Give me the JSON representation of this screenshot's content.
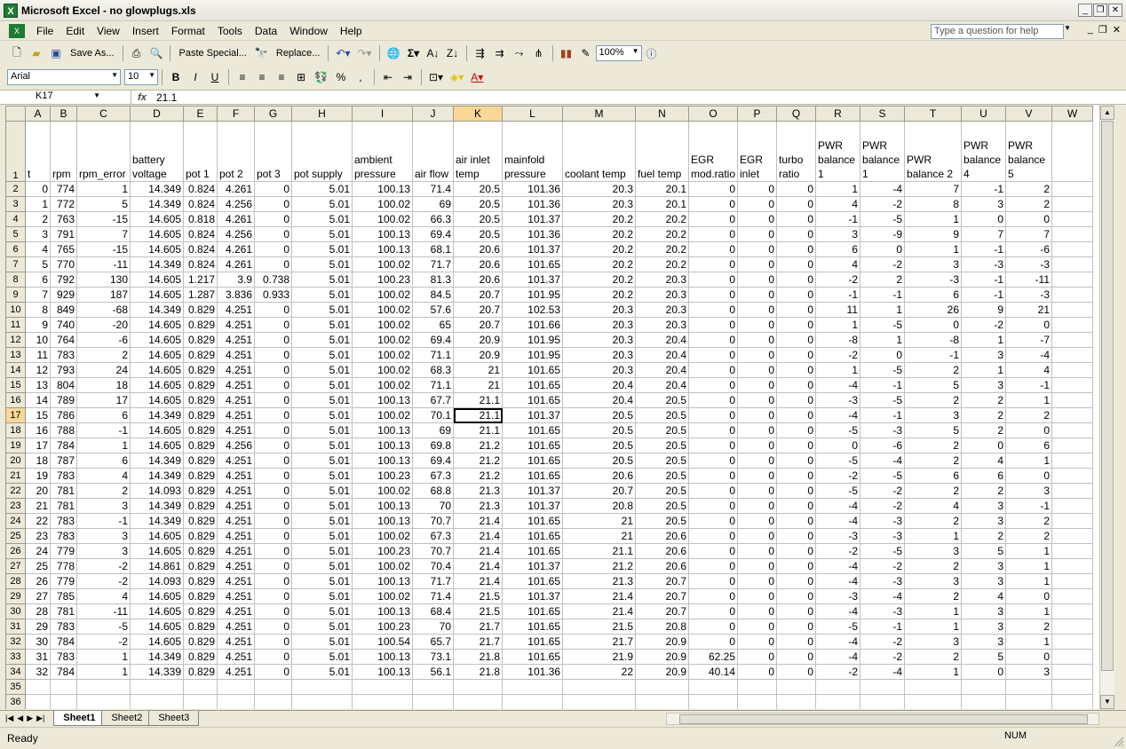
{
  "window": {
    "title": "Microsoft Excel - no glowplugs.xls",
    "app_icon": "X"
  },
  "menu": {
    "items": [
      "File",
      "Edit",
      "View",
      "Insert",
      "Format",
      "Tools",
      "Data",
      "Window",
      "Help"
    ],
    "help_placeholder": "Type a question for help"
  },
  "toolbar": {
    "save_as": "Save As...",
    "paste_special": "Paste Special...",
    "replace": "Replace...",
    "zoom": "100%"
  },
  "format": {
    "font": "Arial",
    "size": "10",
    "bold": "B",
    "italic": "I",
    "underline": "U",
    "percent": "%",
    "comma": ","
  },
  "formula_bar": {
    "name_box": "K17",
    "fx": "fx",
    "value": "21.1"
  },
  "columns": [
    "A",
    "B",
    "C",
    "D",
    "E",
    "F",
    "G",
    "H",
    "I",
    "J",
    "K",
    "L",
    "M",
    "N",
    "O",
    "P",
    "Q",
    "R",
    "S",
    "T",
    "U",
    "V",
    "W"
  ],
  "header_row": [
    "t",
    "rpm",
    "rpm_error",
    "battery voltage",
    "pot 1",
    "pot 2",
    "pot 3",
    "pot supply",
    "ambient pressure",
    "air flow",
    "air inlet temp",
    "mainfold pressure",
    "coolant temp",
    "fuel temp",
    "EGR mod.ratio",
    "EGR inlet",
    "turbo ratio",
    "PWR balance 1",
    "PWR balance 1",
    "PWR balance 2",
    "PWR balance 4",
    "PWR balance 5",
    ""
  ],
  "rows": [
    [
      "0",
      "774",
      "1",
      "14.349",
      "0.824",
      "4.261",
      "0",
      "5.01",
      "100.13",
      "71.4",
      "20.5",
      "101.36",
      "20.3",
      "20.1",
      "0",
      "0",
      "0",
      "1",
      "-4",
      "7",
      "-1",
      "2"
    ],
    [
      "1",
      "772",
      "5",
      "14.349",
      "0.824",
      "4.256",
      "0",
      "5.01",
      "100.02",
      "69",
      "20.5",
      "101.36",
      "20.3",
      "20.1",
      "0",
      "0",
      "0",
      "4",
      "-2",
      "8",
      "3",
      "2"
    ],
    [
      "2",
      "763",
      "-15",
      "14.605",
      "0.818",
      "4.261",
      "0",
      "5.01",
      "100.02",
      "66.3",
      "20.5",
      "101.37",
      "20.2",
      "20.2",
      "0",
      "0",
      "0",
      "-1",
      "-5",
      "1",
      "0",
      "0"
    ],
    [
      "3",
      "791",
      "7",
      "14.605",
      "0.824",
      "4.256",
      "0",
      "5.01",
      "100.13",
      "69.4",
      "20.5",
      "101.36",
      "20.2",
      "20.2",
      "0",
      "0",
      "0",
      "3",
      "-9",
      "9",
      "7",
      "7"
    ],
    [
      "4",
      "765",
      "-15",
      "14.605",
      "0.824",
      "4.261",
      "0",
      "5.01",
      "100.13",
      "68.1",
      "20.6",
      "101.37",
      "20.2",
      "20.2",
      "0",
      "0",
      "0",
      "6",
      "0",
      "1",
      "-1",
      "-6"
    ],
    [
      "5",
      "770",
      "-11",
      "14.349",
      "0.824",
      "4.261",
      "0",
      "5.01",
      "100.02",
      "71.7",
      "20.6",
      "101.65",
      "20.2",
      "20.2",
      "0",
      "0",
      "0",
      "4",
      "-2",
      "3",
      "-3",
      "-3"
    ],
    [
      "6",
      "792",
      "130",
      "14.605",
      "1.217",
      "3.9",
      "0.738",
      "5.01",
      "100.23",
      "81.3",
      "20.6",
      "101.37",
      "20.2",
      "20.3",
      "0",
      "0",
      "0",
      "-2",
      "2",
      "-3",
      "-1",
      "-11"
    ],
    [
      "7",
      "929",
      "187",
      "14.605",
      "1.287",
      "3.836",
      "0.933",
      "5.01",
      "100.02",
      "84.5",
      "20.7",
      "101.95",
      "20.2",
      "20.3",
      "0",
      "0",
      "0",
      "-1",
      "-1",
      "6",
      "-1",
      "-3"
    ],
    [
      "8",
      "849",
      "-68",
      "14.349",
      "0.829",
      "4.251",
      "0",
      "5.01",
      "100.02",
      "57.6",
      "20.7",
      "102.53",
      "20.3",
      "20.3",
      "0",
      "0",
      "0",
      "11",
      "1",
      "26",
      "9",
      "21"
    ],
    [
      "9",
      "740",
      "-20",
      "14.605",
      "0.829",
      "4.251",
      "0",
      "5.01",
      "100.02",
      "65",
      "20.7",
      "101.66",
      "20.3",
      "20.3",
      "0",
      "0",
      "0",
      "1",
      "-5",
      "0",
      "-2",
      "0"
    ],
    [
      "10",
      "764",
      "-6",
      "14.605",
      "0.829",
      "4.251",
      "0",
      "5.01",
      "100.02",
      "69.4",
      "20.9",
      "101.95",
      "20.3",
      "20.4",
      "0",
      "0",
      "0",
      "-8",
      "1",
      "-8",
      "1",
      "-7"
    ],
    [
      "11",
      "783",
      "2",
      "14.605",
      "0.829",
      "4.251",
      "0",
      "5.01",
      "100.02",
      "71.1",
      "20.9",
      "101.95",
      "20.3",
      "20.4",
      "0",
      "0",
      "0",
      "-2",
      "0",
      "-1",
      "3",
      "-4"
    ],
    [
      "12",
      "793",
      "24",
      "14.605",
      "0.829",
      "4.251",
      "0",
      "5.01",
      "100.02",
      "68.3",
      "21",
      "101.65",
      "20.3",
      "20.4",
      "0",
      "0",
      "0",
      "1",
      "-5",
      "2",
      "1",
      "4"
    ],
    [
      "13",
      "804",
      "18",
      "14.605",
      "0.829",
      "4.251",
      "0",
      "5.01",
      "100.02",
      "71.1",
      "21",
      "101.65",
      "20.4",
      "20.4",
      "0",
      "0",
      "0",
      "-4",
      "-1",
      "5",
      "3",
      "-1"
    ],
    [
      "14",
      "789",
      "17",
      "14.605",
      "0.829",
      "4.251",
      "0",
      "5.01",
      "100.13",
      "67.7",
      "21.1",
      "101.65",
      "20.4",
      "20.5",
      "0",
      "0",
      "0",
      "-3",
      "-5",
      "2",
      "2",
      "1"
    ],
    [
      "15",
      "786",
      "6",
      "14.349",
      "0.829",
      "4.251",
      "0",
      "5.01",
      "100.02",
      "70.1",
      "21.1",
      "101.37",
      "20.5",
      "20.5",
      "0",
      "0",
      "0",
      "-4",
      "-1",
      "3",
      "2",
      "2"
    ],
    [
      "16",
      "788",
      "-1",
      "14.605",
      "0.829",
      "4.251",
      "0",
      "5.01",
      "100.13",
      "69",
      "21.1",
      "101.65",
      "20.5",
      "20.5",
      "0",
      "0",
      "0",
      "-5",
      "-3",
      "5",
      "2",
      "0"
    ],
    [
      "17",
      "784",
      "1",
      "14.605",
      "0.829",
      "4.256",
      "0",
      "5.01",
      "100.13",
      "69.8",
      "21.2",
      "101.65",
      "20.5",
      "20.5",
      "0",
      "0",
      "0",
      "0",
      "-6",
      "2",
      "0",
      "6"
    ],
    [
      "18",
      "787",
      "6",
      "14.349",
      "0.829",
      "4.251",
      "0",
      "5.01",
      "100.13",
      "69.4",
      "21.2",
      "101.65",
      "20.5",
      "20.5",
      "0",
      "0",
      "0",
      "-5",
      "-4",
      "2",
      "4",
      "1"
    ],
    [
      "19",
      "783",
      "4",
      "14.349",
      "0.829",
      "4.251",
      "0",
      "5.01",
      "100.23",
      "67.3",
      "21.2",
      "101.65",
      "20.6",
      "20.5",
      "0",
      "0",
      "0",
      "-2",
      "-5",
      "6",
      "6",
      "0"
    ],
    [
      "20",
      "781",
      "2",
      "14.093",
      "0.829",
      "4.251",
      "0",
      "5.01",
      "100.02",
      "68.8",
      "21.3",
      "101.37",
      "20.7",
      "20.5",
      "0",
      "0",
      "0",
      "-5",
      "-2",
      "2",
      "2",
      "3"
    ],
    [
      "21",
      "781",
      "3",
      "14.349",
      "0.829",
      "4.251",
      "0",
      "5.01",
      "100.13",
      "70",
      "21.3",
      "101.37",
      "20.8",
      "20.5",
      "0",
      "0",
      "0",
      "-4",
      "-2",
      "4",
      "3",
      "-1"
    ],
    [
      "22",
      "783",
      "-1",
      "14.349",
      "0.829",
      "4.251",
      "0",
      "5.01",
      "100.13",
      "70.7",
      "21.4",
      "101.65",
      "21",
      "20.5",
      "0",
      "0",
      "0",
      "-4",
      "-3",
      "2",
      "3",
      "2"
    ],
    [
      "23",
      "783",
      "3",
      "14.605",
      "0.829",
      "4.251",
      "0",
      "5.01",
      "100.02",
      "67.3",
      "21.4",
      "101.65",
      "21",
      "20.6",
      "0",
      "0",
      "0",
      "-3",
      "-3",
      "1",
      "2",
      "2"
    ],
    [
      "24",
      "779",
      "3",
      "14.605",
      "0.829",
      "4.251",
      "0",
      "5.01",
      "100.23",
      "70.7",
      "21.4",
      "101.65",
      "21.1",
      "20.6",
      "0",
      "0",
      "0",
      "-2",
      "-5",
      "3",
      "5",
      "1"
    ],
    [
      "25",
      "778",
      "-2",
      "14.861",
      "0.829",
      "4.251",
      "0",
      "5.01",
      "100.02",
      "70.4",
      "21.4",
      "101.37",
      "21.2",
      "20.6",
      "0",
      "0",
      "0",
      "-4",
      "-2",
      "2",
      "3",
      "1"
    ],
    [
      "26",
      "779",
      "-2",
      "14.093",
      "0.829",
      "4.251",
      "0",
      "5.01",
      "100.13",
      "71.7",
      "21.4",
      "101.65",
      "21.3",
      "20.7",
      "0",
      "0",
      "0",
      "-4",
      "-3",
      "3",
      "3",
      "1"
    ],
    [
      "27",
      "785",
      "4",
      "14.605",
      "0.829",
      "4.251",
      "0",
      "5.01",
      "100.02",
      "71.4",
      "21.5",
      "101.37",
      "21.4",
      "20.7",
      "0",
      "0",
      "0",
      "-3",
      "-4",
      "2",
      "4",
      "0"
    ],
    [
      "28",
      "781",
      "-11",
      "14.605",
      "0.829",
      "4.251",
      "0",
      "5.01",
      "100.13",
      "68.4",
      "21.5",
      "101.65",
      "21.4",
      "20.7",
      "0",
      "0",
      "0",
      "-4",
      "-3",
      "1",
      "3",
      "1"
    ],
    [
      "29",
      "783",
      "-5",
      "14.605",
      "0.829",
      "4.251",
      "0",
      "5.01",
      "100.23",
      "70",
      "21.7",
      "101.65",
      "21.5",
      "20.8",
      "0",
      "0",
      "0",
      "-5",
      "-1",
      "1",
      "3",
      "2"
    ],
    [
      "30",
      "784",
      "-2",
      "14.605",
      "0.829",
      "4.251",
      "0",
      "5.01",
      "100.54",
      "65.7",
      "21.7",
      "101.65",
      "21.7",
      "20.9",
      "0",
      "0",
      "0",
      "-4",
      "-2",
      "3",
      "3",
      "1"
    ],
    [
      "31",
      "783",
      "1",
      "14.349",
      "0.829",
      "4.251",
      "0",
      "5.01",
      "100.13",
      "73.1",
      "21.8",
      "101.65",
      "21.9",
      "20.9",
      "62.25",
      "0",
      "0",
      "-4",
      "-2",
      "2",
      "5",
      "0"
    ],
    [
      "32",
      "784",
      "1",
      "14.339",
      "0.829",
      "4.251",
      "0",
      "5.01",
      "100.13",
      "56.1",
      "21.8",
      "101.36",
      "22",
      "20.9",
      "40.14",
      "0",
      "0",
      "-2",
      "-4",
      "1",
      "0",
      "3"
    ]
  ],
  "empty_rows": [
    "35",
    "36",
    "37"
  ],
  "sheets": [
    "Sheet1",
    "Sheet2",
    "Sheet3"
  ],
  "status": {
    "left": "Ready",
    "num": "NUM"
  }
}
